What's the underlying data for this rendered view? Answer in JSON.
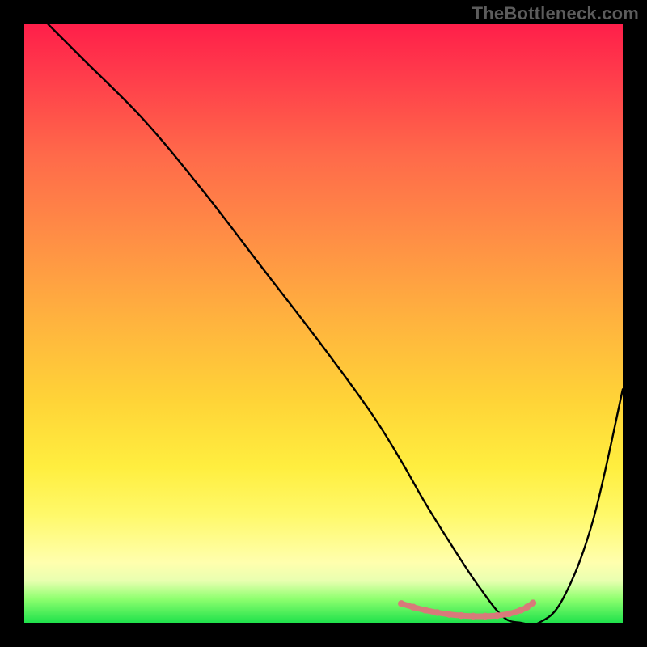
{
  "watermark": "TheBottleneck.com",
  "colors": {
    "background": "#000000",
    "curve": "#000000",
    "pink_accent": "#d87a7a",
    "watermark_text": "#5c5c5c",
    "gradient_top": "#ff1f4a",
    "gradient_bottom": "#1fe24b"
  },
  "chart_data": {
    "type": "line",
    "title": "",
    "xlabel": "",
    "ylabel": "",
    "xlim": [
      0,
      100
    ],
    "ylim": [
      0,
      100
    ],
    "grid": false,
    "series": [
      {
        "name": "main-curve",
        "x": [
          4,
          10,
          20,
          30,
          40,
          50,
          58,
          63,
          67,
          72,
          76,
          80,
          83,
          86,
          90,
          95,
          100
        ],
        "values": [
          100,
          94,
          84,
          72,
          59,
          46,
          35,
          27,
          20,
          12,
          6,
          1,
          0,
          0,
          4,
          17,
          39
        ]
      },
      {
        "name": "pink-accent",
        "x": [
          63,
          65,
          67,
          69,
          71,
          73,
          75,
          77,
          79,
          81,
          83,
          84,
          85
        ],
        "values": [
          3.2,
          2.6,
          2.1,
          1.7,
          1.4,
          1.2,
          1.1,
          1.1,
          1.2,
          1.5,
          2.1,
          2.6,
          3.3
        ]
      }
    ]
  }
}
